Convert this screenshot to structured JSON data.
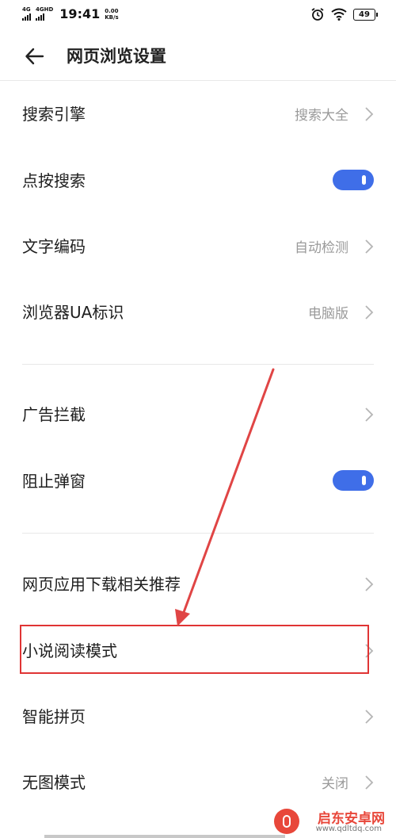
{
  "status_bar": {
    "net1": "4G",
    "net2": "4GHD",
    "time": "19:41",
    "speed_value": "0.00",
    "speed_unit": "KB/s",
    "battery": "49"
  },
  "header": {
    "title": "网页浏览设置"
  },
  "settings": [
    {
      "label": "搜索引擎",
      "value": "搜索大全",
      "control": "chevron"
    },
    {
      "label": "点按搜索",
      "control": "toggle",
      "on": true
    },
    {
      "label": "文字编码",
      "value": "自动检测",
      "control": "chevron"
    },
    {
      "label": "浏览器UA标识",
      "value": "电脑版",
      "control": "chevron"
    },
    {
      "label": "广告拦截",
      "control": "chevron"
    },
    {
      "label": "阻止弹窗",
      "control": "toggle",
      "on": true
    },
    {
      "label": "网页应用下载相关推荐",
      "control": "chevron"
    },
    {
      "label": "小说阅读模式",
      "control": "chevron"
    },
    {
      "label": "智能拼页",
      "control": "chevron"
    },
    {
      "label": "无图模式",
      "value": "关闭",
      "control": "chevron"
    }
  ],
  "watermark": {
    "brand": "启东安卓网",
    "url": "www.qdltdq.com"
  },
  "colors": {
    "toggle_on": "#3f6ee8",
    "annotation_red": "#e03434",
    "value_gray": "#9a9a9a"
  }
}
